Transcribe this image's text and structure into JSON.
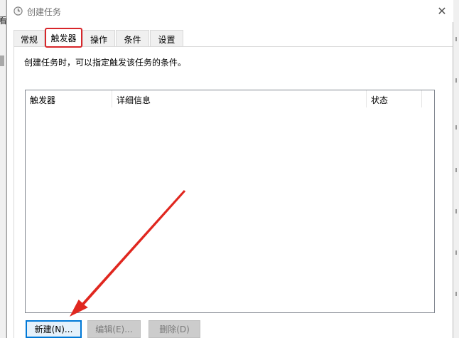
{
  "background": {
    "left_glyph": "看"
  },
  "window": {
    "title": "创建任务",
    "close_label": "✕"
  },
  "tabs": [
    {
      "label": "常规"
    },
    {
      "label": "触发器"
    },
    {
      "label": "操作"
    },
    {
      "label": "条件"
    },
    {
      "label": "设置"
    }
  ],
  "active_tab_index": 1,
  "triggers_page": {
    "description": "创建任务时，可以指定触发该任务的条件。",
    "columns": [
      {
        "label": "触发器"
      },
      {
        "label": "详细信息"
      },
      {
        "label": "状态"
      }
    ],
    "rows": []
  },
  "buttons": {
    "new_label": "新建(N)...",
    "edit_label": "编辑(E)...",
    "delete_label": "删除(D)"
  },
  "colors": {
    "annotation_red": "#e0271f",
    "focus_blue": "#0078d7"
  }
}
